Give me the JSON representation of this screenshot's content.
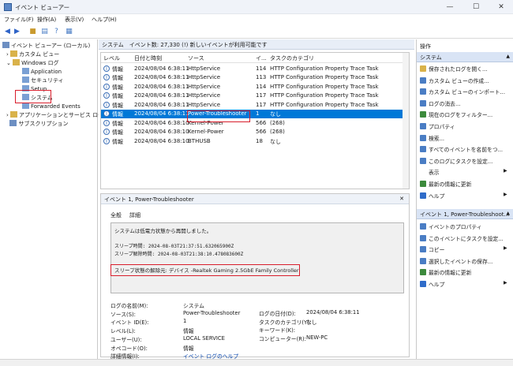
{
  "window": {
    "title": "イベント ビューアー"
  },
  "menu": [
    "ファイル(F)",
    "操作(A)",
    "表示(V)",
    "ヘルプ(H)"
  ],
  "tree": {
    "root": "イベント ビューアー (ローカル)",
    "custom": "カスタム ビュー",
    "winlogs": "Windows ログ",
    "items": [
      "Application",
      "セキュリティ",
      "Setup",
      "システム",
      "Forwarded Events"
    ],
    "apps": "アプリケーションとサービス ログ",
    "subs": "サブスクリプション"
  },
  "center": {
    "header": "システム　イベント数: 27,330 (!) 新しいイベントが利用可能です",
    "columns": [
      "レベル",
      "日付と時刻",
      "ソース",
      "イ...",
      "タスクのカテゴリ"
    ],
    "rows": [
      [
        "情報",
        "2024/08/04 6:38:11",
        "HttpService",
        "114",
        "HTTP Configuration Property Trace Task"
      ],
      [
        "情報",
        "2024/08/04 6:38:11",
        "HttpService",
        "113",
        "HTTP Configuration Property Trace Task"
      ],
      [
        "情報",
        "2024/08/04 6:38:11",
        "HttpService",
        "114",
        "HTTP Configuration Property Trace Task"
      ],
      [
        "情報",
        "2024/08/04 6:38:11",
        "HttpService",
        "117",
        "HTTP Configuration Property Trace Task"
      ],
      [
        "情報",
        "2024/08/04 6:38:11",
        "HttpService",
        "117",
        "HTTP Configuration Property Trace Task"
      ],
      [
        "情報",
        "2024/08/04 6:38:11",
        "Power-Troubleshooter",
        "1",
        "なし"
      ],
      [
        "情報",
        "2024/08/04 6:38:10",
        "Kernel-Power",
        "566",
        "(268)"
      ],
      [
        "情報",
        "2024/08/04 6:38:10",
        "Kernel-Power",
        "566",
        "(268)"
      ],
      [
        "情報",
        "2024/08/04 6:38:10",
        "BTHUSB",
        "18",
        "なし"
      ]
    ]
  },
  "detail": {
    "title": "イベント 1, Power-Troubleshooter",
    "tabs": [
      "全般",
      "詳細"
    ],
    "msg1": "システムは低電力状態から再開しました。",
    "msg2": "スリープ時間: 2024-08-03T21:37:51.632065900Z",
    "msg3": "スリープ解除時間: 2024-08-03T21:38:10.478083600Z",
    "msg4": "スリープ状態の解除元: デバイス -Realtek Gaming 2.5GbE Family Controller",
    "props": [
      [
        "ログの名前(M):",
        "システム"
      ],
      [
        "ソース(S):",
        "Power-Troubleshooter"
      ],
      [
        "イベント ID(E):",
        "1"
      ],
      [
        "レベル(L):",
        "情報"
      ],
      [
        "ユーザー(U):",
        "LOCAL SERVICE"
      ],
      [
        "オペコード(O):",
        "情報"
      ],
      [
        "詳細情報(I):",
        "イベント ログのヘルプ"
      ]
    ],
    "props2": [
      [
        "ログの日付(D):",
        "2024/08/04 6:38:11"
      ],
      [
        "タスクのカテゴリ(Y):",
        "なし"
      ],
      [
        "キーワード(K):",
        ""
      ],
      [
        "コンピューター(R):",
        "NEW-PC"
      ]
    ]
  },
  "actions": {
    "header": "操作",
    "sec1": "システム",
    "items1": [
      "保存されたログを開く...",
      "カスタム ビューの作成...",
      "カスタム ビューのインポート...",
      "ログの消去...",
      "現在のログをフィルター...",
      "プロパティ",
      "検索...",
      "すべてのイベントを名前をつ...",
      "このログにタスクを設定...",
      "表示",
      "最新の情報に更新",
      "ヘルプ"
    ],
    "sec2": "イベント 1, Power-Troubleshoot...",
    "items2": [
      "イベントのプロパティ",
      "このイベントにタスクを設定...",
      "コピー",
      "選択したイベントの保存...",
      "最新の情報に更新",
      "ヘルプ"
    ]
  }
}
